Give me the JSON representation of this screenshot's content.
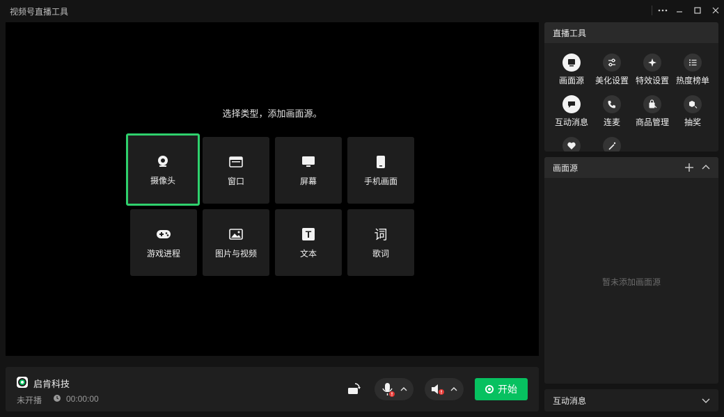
{
  "window": {
    "title": "视频号直播工具",
    "controls": [
      "more-icon",
      "minimize-icon",
      "maximize-icon",
      "close-icon"
    ]
  },
  "preview": {
    "hint": "选择类型，添加画面源。",
    "sources": [
      {
        "label": "摄像头",
        "icon": "camera-icon",
        "selected": true
      },
      {
        "label": "窗口",
        "icon": "window-icon",
        "selected": false
      },
      {
        "label": "屏幕",
        "icon": "monitor-icon",
        "selected": false
      },
      {
        "label": "手机画面",
        "icon": "phone-icon",
        "selected": false
      },
      {
        "label": "游戏进程",
        "icon": "gamepad-icon",
        "selected": false
      },
      {
        "label": "图片与视频",
        "icon": "image-icon",
        "selected": false
      },
      {
        "label": "文本",
        "icon": "text-icon",
        "selected": false
      },
      {
        "label": "歌词",
        "icon": "lyrics-icon",
        "selected": false
      }
    ],
    "lyrics_glyph": "词",
    "text_glyph": "T"
  },
  "bottom": {
    "account_name": "启肯科技",
    "status": "未开播",
    "time": "00:00:00",
    "start_label": "开始"
  },
  "tools_panel": {
    "title": "直播工具",
    "tools": [
      {
        "label": "画面源",
        "icon": "screen-source-icon"
      },
      {
        "label": "美化设置",
        "icon": "sliders-icon"
      },
      {
        "label": "特效设置",
        "icon": "sparkle-icon"
      },
      {
        "label": "热度榜单",
        "icon": "list-icon"
      },
      {
        "label": "互动消息",
        "icon": "message-icon"
      },
      {
        "label": "连麦",
        "icon": "call-icon"
      },
      {
        "label": "商品管理",
        "icon": "shopping-bag-icon"
      },
      {
        "label": "抽奖",
        "icon": "gift-icon"
      },
      {
        "label": "",
        "icon": "heart-icon"
      },
      {
        "label": "",
        "icon": "wand-icon"
      }
    ]
  },
  "sources_panel": {
    "title": "画面源",
    "empty_text": "暂未添加画面源"
  },
  "messages_panel": {
    "title": "互动消息"
  },
  "colors": {
    "accent": "#07c160",
    "selected_border": "#2fd16d",
    "background": "#141414",
    "panel": "#1f1f1f",
    "alert": "#e53935"
  }
}
